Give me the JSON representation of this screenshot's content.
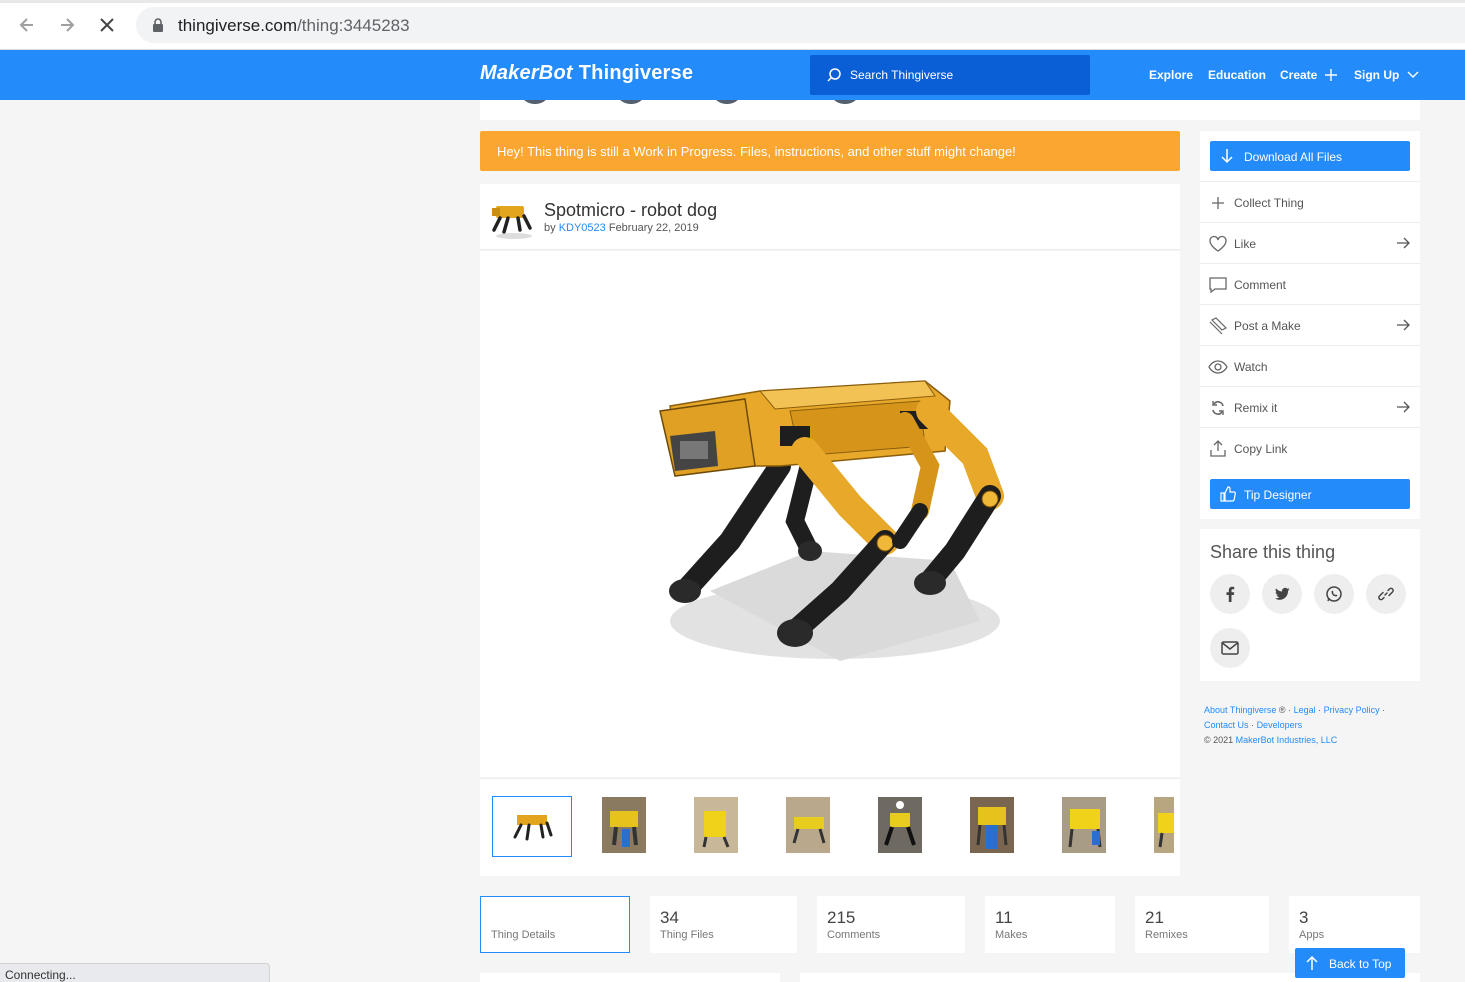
{
  "browser": {
    "url_host": "thingiverse.com",
    "url_path": "/thing:3445283",
    "status_text": "Connecting..."
  },
  "header": {
    "logo_text": "MakerBot",
    "logo_product": "Thingiverse",
    "search_placeholder": "Search Thingiverse",
    "nav": {
      "explore": "Explore",
      "education": "Education",
      "create": "Create",
      "signup": "Sign Up"
    },
    "brand_color": "#248bfb"
  },
  "banner": {
    "text": "Hey! This thing is still a Work in Progress. Files, instructions, and other stuff might change!",
    "color": "#fba631"
  },
  "thing": {
    "title": "Spotmicro - robot dog",
    "by_label": "by",
    "author": "KDY0523",
    "date": "February 22, 2019"
  },
  "thumbnails_count": 8,
  "actions": {
    "download": "Download All Files",
    "items": [
      {
        "label": "Collect Thing",
        "icon": "plus-icon",
        "arrow": false
      },
      {
        "label": "Like",
        "icon": "heart-icon",
        "arrow": true
      },
      {
        "label": "Comment",
        "icon": "comment-icon",
        "arrow": false
      },
      {
        "label": "Post a Make",
        "icon": "make-icon",
        "arrow": true
      },
      {
        "label": "Watch",
        "icon": "eye-icon",
        "arrow": false
      },
      {
        "label": "Remix it",
        "icon": "remix-icon",
        "arrow": true
      },
      {
        "label": "Copy Link",
        "icon": "share-upload-icon",
        "arrow": false
      }
    ],
    "tip": "Tip Designer"
  },
  "share": {
    "title": "Share this thing",
    "buttons": [
      "facebook-icon",
      "twitter-icon",
      "whatsapp-icon",
      "link-icon",
      "mail-icon"
    ]
  },
  "footer": {
    "about": "About Thingiverse",
    "reg": "®",
    "legal": "Legal",
    "privacy": "Privacy Policy",
    "contact": "Contact Us",
    "developers": "Developers",
    "copyright": "©  2021",
    "company": "MakerBot Industries, LLC",
    "sep": "·"
  },
  "stats": [
    {
      "number": "",
      "label": "Thing Details"
    },
    {
      "number": "34",
      "label": "Thing Files"
    },
    {
      "number": "215",
      "label": "Comments"
    },
    {
      "number": "11",
      "label": "Makes"
    },
    {
      "number": "21",
      "label": "Remixes"
    },
    {
      "number": "3",
      "label": "Apps"
    }
  ],
  "back_to_top": "Back to Top"
}
